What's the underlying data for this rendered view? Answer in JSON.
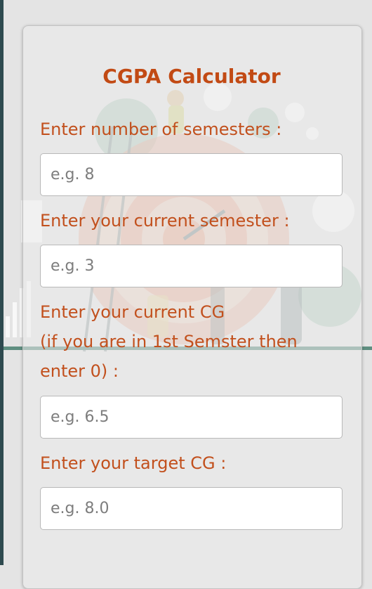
{
  "title": "CGPA Calculator",
  "fields": [
    {
      "label": "Enter number of semesters :",
      "placeholder": "e.g. 8"
    },
    {
      "label": "Enter your current semester :",
      "placeholder": "e.g. 3"
    },
    {
      "label_lines": [
        "Enter your current CG",
        "(if you are in 1st Semster then",
        "enter 0) :"
      ],
      "placeholder": "e.g. 6.5"
    },
    {
      "label": "Enter your target CG :",
      "placeholder": "e.g. 8.0"
    }
  ],
  "colors": {
    "accent": "#c24a14",
    "label": "#c2501d",
    "teal": "#5f8e80",
    "target_ring": "#e6a48c"
  }
}
